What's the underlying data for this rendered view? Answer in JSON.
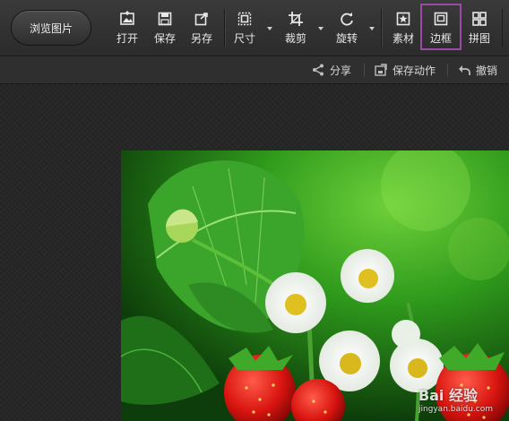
{
  "toolbar": {
    "browse_label": "浏览图片",
    "items": [
      {
        "label": "打开",
        "icon": "open-image-icon"
      },
      {
        "label": "保存",
        "icon": "save-icon"
      },
      {
        "label": "另存",
        "icon": "save-as-icon"
      },
      {
        "label": "尺寸",
        "icon": "resize-icon"
      },
      {
        "label": "裁剪",
        "icon": "crop-icon"
      },
      {
        "label": "旋转",
        "icon": "rotate-icon"
      },
      {
        "label": "素材",
        "icon": "sticker-icon"
      },
      {
        "label": "边框",
        "icon": "frame-icon"
      },
      {
        "label": "拼图",
        "icon": "collage-icon"
      }
    ],
    "highlighted": "边框"
  },
  "actionbar": {
    "share_label": "分享",
    "save_action_label": "保存动作",
    "undo_label": "撤销"
  },
  "watermark": {
    "text": "Bai 经验",
    "sub": "jingyan.baidu.com"
  },
  "colors": {
    "highlight_border": "#9b4aa6",
    "toolbar_bg": "#333333",
    "canvas_bg": "#242424"
  }
}
